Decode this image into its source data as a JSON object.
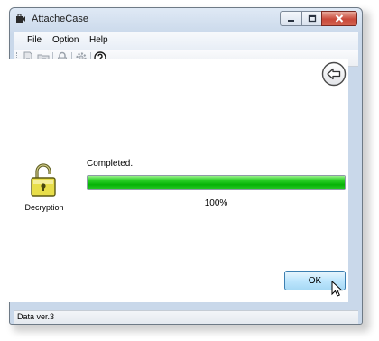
{
  "window": {
    "title": "AttacheCase",
    "accent_color": "#c9493a"
  },
  "menu": {
    "items": [
      {
        "label": "File"
      },
      {
        "label": "Option"
      },
      {
        "label": "Help"
      }
    ]
  },
  "toolbar": {
    "icons": [
      "encrypt-file-icon",
      "encrypt-folder-icon",
      "decrypt-icon",
      "settings-gear-icon",
      "help-icon"
    ]
  },
  "main": {
    "mode_icon": "unlocked-padlock-icon",
    "mode_label": "Decryption",
    "status_text": "Completed.",
    "progress_fraction": 1.0,
    "progress_label": "100%",
    "progress_color": "#06b306",
    "ok_label": "OK",
    "back_icon": "back-arrow-icon"
  },
  "statusbar": {
    "text": "Data ver.3"
  }
}
